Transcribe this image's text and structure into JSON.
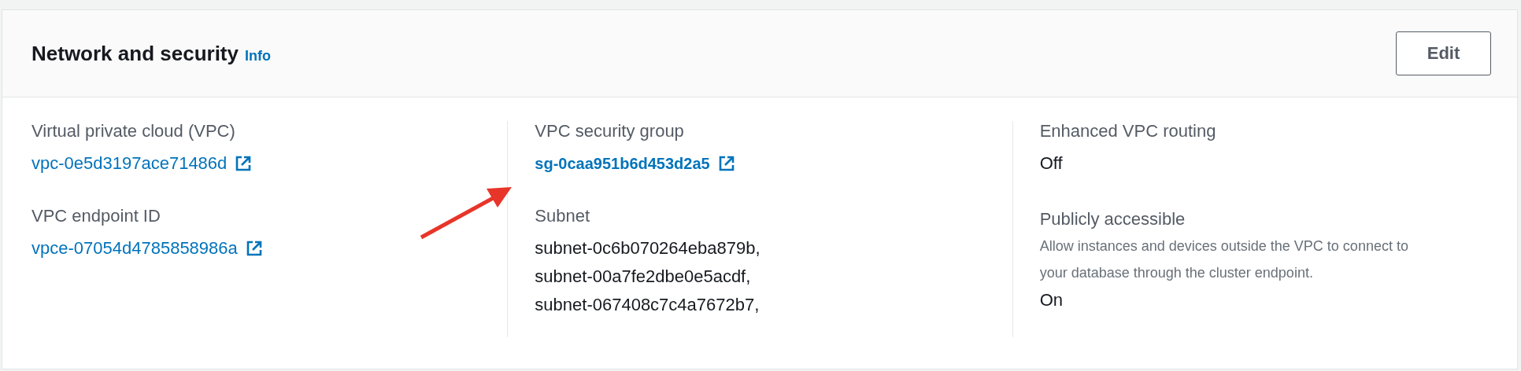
{
  "panel": {
    "title": "Network and security",
    "info_link": "Info",
    "edit_button": "Edit",
    "columns": [
      {
        "fields": [
          {
            "label": "Virtual private cloud (VPC)",
            "kind": "link",
            "bold": false,
            "values": [
              "vpc-0e5d3197ace71486d"
            ]
          },
          {
            "label": "VPC endpoint ID",
            "kind": "link",
            "bold": false,
            "values": [
              "vpce-07054d4785858986a"
            ]
          }
        ]
      },
      {
        "fields": [
          {
            "label": "VPC security group",
            "kind": "link",
            "bold": true,
            "values": [
              "sg-0caa951b6d453d2a5"
            ]
          },
          {
            "label": "Subnet",
            "kind": "text",
            "bold": false,
            "values": [
              "subnet-0c6b070264eba879b,",
              "subnet-00a7fe2dbe0e5acdf,",
              "subnet-067408c7c4a7672b7,"
            ]
          }
        ]
      },
      {
        "fields": [
          {
            "label": "Enhanced VPC routing",
            "kind": "text",
            "bold": false,
            "values": [
              "Off"
            ]
          },
          {
            "label": "Publicly accessible",
            "kind": "text",
            "bold": false,
            "description": "Allow instances and devices outside the VPC to connect to your database through the cluster endpoint.",
            "values": [
              "On"
            ]
          }
        ]
      }
    ]
  },
  "annotations": [
    {
      "kind": "arrow"
    }
  ]
}
